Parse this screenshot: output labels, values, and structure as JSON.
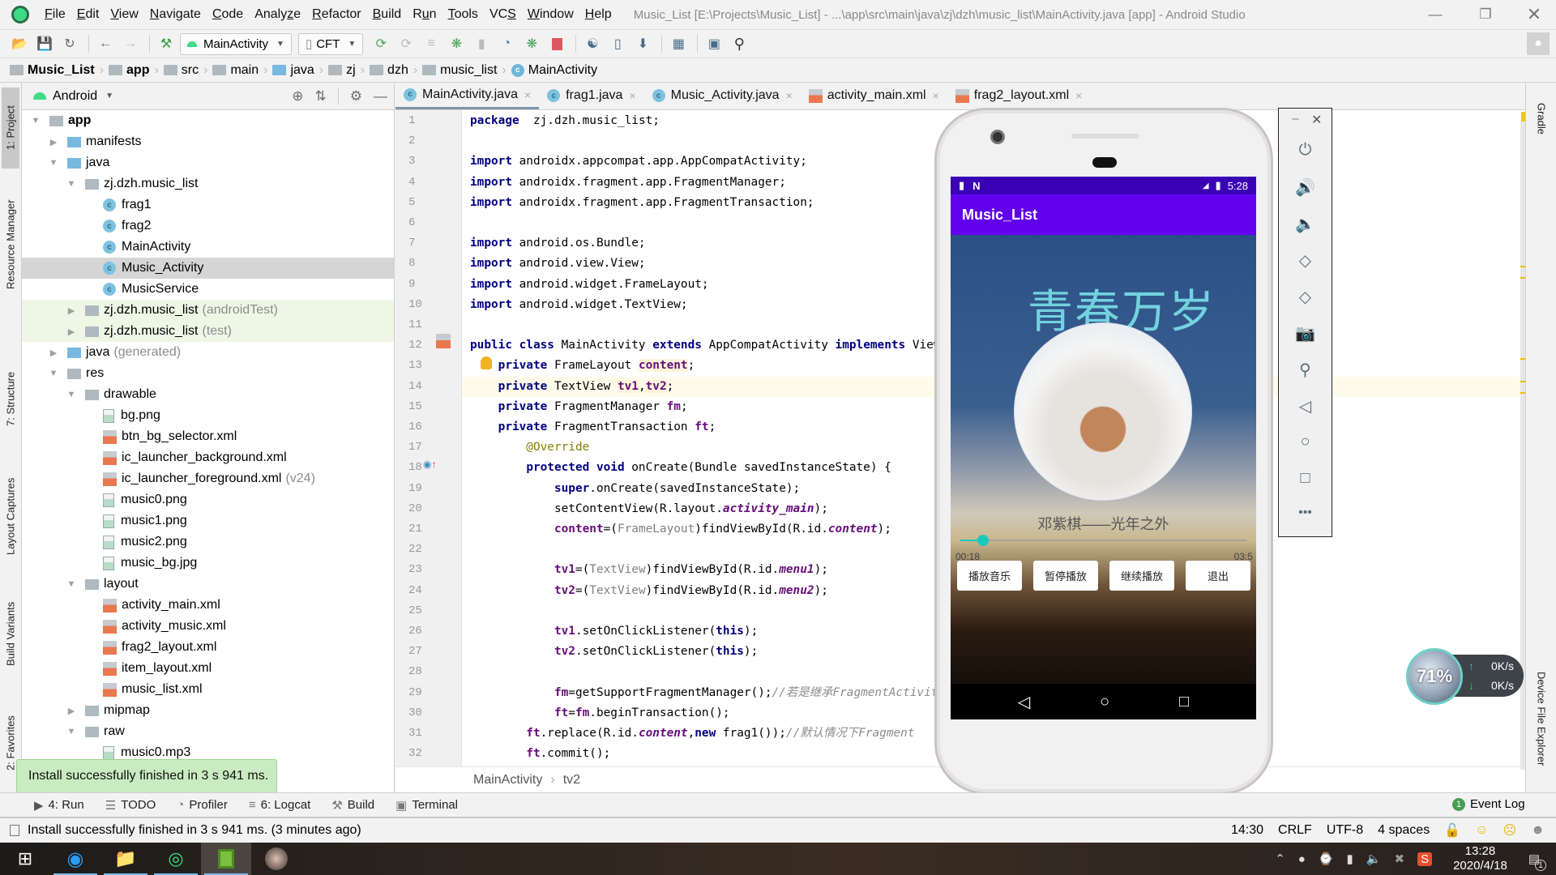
{
  "menu": {
    "items": [
      {
        "label": "File",
        "u": "F"
      },
      {
        "label": "Edit",
        "u": "E"
      },
      {
        "label": "View",
        "u": "V"
      },
      {
        "label": "Navigate",
        "u": "N"
      },
      {
        "label": "Code",
        "u": "C"
      },
      {
        "label": "Analyze",
        "u": "z"
      },
      {
        "label": "Refactor",
        "u": "R"
      },
      {
        "label": "Build",
        "u": "B"
      },
      {
        "label": "Run",
        "u": "u"
      },
      {
        "label": "Tools",
        "u": "T"
      },
      {
        "label": "VCS",
        "u": "S"
      },
      {
        "label": "Window",
        "u": "W"
      },
      {
        "label": "Help",
        "u": "H"
      }
    ],
    "title": "Music_List [E:\\Projects\\Music_List] - ...\\app\\src\\main\\java\\zj\\dzh\\music_list\\MainActivity.java [app] - Android Studio"
  },
  "toolbar": {
    "run_config": "MainActivity",
    "device": "CFT"
  },
  "breadcrumb": [
    "Music_List",
    "app",
    "src",
    "main",
    "java",
    "zj",
    "dzh",
    "music_list",
    "MainActivity"
  ],
  "left_tool_windows": [
    "1: Project",
    "Resource Manager",
    "7: Structure",
    "Layout Captures",
    "Build Variants",
    "2: Favorites"
  ],
  "right_tool_windows": [
    "Gradle",
    "Device File Explorer"
  ],
  "project": {
    "view_mode": "Android",
    "tree": [
      {
        "label": "app",
        "depth": 0,
        "type": "module",
        "expanded": true,
        "bold": true
      },
      {
        "label": "manifests",
        "depth": 1,
        "type": "folder-blue",
        "expanded": false
      },
      {
        "label": "java",
        "depth": 1,
        "type": "folder-blue",
        "expanded": true
      },
      {
        "label": "zj.dzh.music_list",
        "depth": 2,
        "type": "package",
        "expanded": true
      },
      {
        "label": "frag1",
        "depth": 3,
        "type": "class"
      },
      {
        "label": "frag2",
        "depth": 3,
        "type": "class"
      },
      {
        "label": "MainActivity",
        "depth": 3,
        "type": "class"
      },
      {
        "label": "Music_Activity",
        "depth": 3,
        "type": "class",
        "selected": true
      },
      {
        "label": "MusicService",
        "depth": 3,
        "type": "class"
      },
      {
        "label": "zj.dzh.music_list",
        "suffix": "(androidTest)",
        "depth": 2,
        "type": "package",
        "expanded": false,
        "test": true
      },
      {
        "label": "zj.dzh.music_list",
        "suffix": "(test)",
        "depth": 2,
        "type": "package",
        "expanded": false,
        "test": true
      },
      {
        "label": "java",
        "suffix": "(generated)",
        "depth": 1,
        "type": "folder-gen",
        "expanded": false
      },
      {
        "label": "res",
        "depth": 1,
        "type": "folder",
        "expanded": true
      },
      {
        "label": "drawable",
        "depth": 2,
        "type": "package",
        "expanded": true
      },
      {
        "label": "bg.png",
        "depth": 3,
        "type": "image"
      },
      {
        "label": "btn_bg_selector.xml",
        "depth": 3,
        "type": "xml"
      },
      {
        "label": "ic_launcher_background.xml",
        "depth": 3,
        "type": "xml"
      },
      {
        "label": "ic_launcher_foreground.xml",
        "suffix": "(v24)",
        "depth": 3,
        "type": "xml"
      },
      {
        "label": "music0.png",
        "depth": 3,
        "type": "image"
      },
      {
        "label": "music1.png",
        "depth": 3,
        "type": "image"
      },
      {
        "label": "music2.png",
        "depth": 3,
        "type": "image"
      },
      {
        "label": "music_bg.jpg",
        "depth": 3,
        "type": "image"
      },
      {
        "label": "layout",
        "depth": 2,
        "type": "package",
        "expanded": true
      },
      {
        "label": "activity_main.xml",
        "depth": 3,
        "type": "xml"
      },
      {
        "label": "activity_music.xml",
        "depth": 3,
        "type": "xml"
      },
      {
        "label": "frag2_layout.xml",
        "depth": 3,
        "type": "xml"
      },
      {
        "label": "item_layout.xml",
        "depth": 3,
        "type": "xml"
      },
      {
        "label": "music_list.xml",
        "depth": 3,
        "type": "xml"
      },
      {
        "label": "mipmap",
        "depth": 2,
        "type": "package",
        "expanded": false
      },
      {
        "label": "raw",
        "depth": 2,
        "type": "package",
        "expanded": true
      },
      {
        "label": "music0.mp3",
        "depth": 3,
        "type": "image"
      }
    ]
  },
  "editor": {
    "tabs": [
      {
        "label": "MainActivity.java",
        "type": "class",
        "active": true
      },
      {
        "label": "frag1.java",
        "type": "class"
      },
      {
        "label": "Music_Activity.java",
        "type": "class"
      },
      {
        "label": "activity_main.xml",
        "type": "xml"
      },
      {
        "label": "frag2_layout.xml",
        "type": "xml"
      }
    ],
    "lines": [
      [
        [
          "kw",
          "package"
        ],
        [
          "",
          "  zj.dzh.music_list;"
        ]
      ],
      [],
      [
        [
          "kw",
          "import"
        ],
        [
          "",
          " androidx.appcompat.app.AppCompatActivity;"
        ]
      ],
      [
        [
          "kw",
          "import"
        ],
        [
          "",
          " androidx.fragment.app.FragmentManager;"
        ]
      ],
      [
        [
          "kw",
          "import"
        ],
        [
          "",
          " androidx.fragment.app.FragmentTransaction;"
        ]
      ],
      [],
      [
        [
          "kw",
          "import"
        ],
        [
          "",
          " android.os.Bundle;"
        ]
      ],
      [
        [
          "kw",
          "import"
        ],
        [
          "",
          " android.view.View;"
        ]
      ],
      [
        [
          "kw",
          "import"
        ],
        [
          "",
          " android.widget.FrameLayout;"
        ]
      ],
      [
        [
          "kw",
          "import"
        ],
        [
          "",
          " android.widget.TextView;"
        ]
      ],
      [],
      [
        [
          "kw",
          "public class"
        ],
        [
          "",
          " MainActivity "
        ],
        [
          "kw",
          "extends"
        ],
        [
          "",
          " AppCompatActivity "
        ],
        [
          "kw",
          "implements"
        ],
        [
          "",
          " View.OnClickListener {"
        ]
      ],
      [
        [
          "",
          "    "
        ],
        [
          "kw",
          "private"
        ],
        [
          "",
          " FrameLayout "
        ],
        [
          "fld hl",
          "content"
        ],
        [
          "",
          ";"
        ]
      ],
      [
        [
          "",
          "    "
        ],
        [
          "kw",
          "private"
        ],
        [
          "",
          " TextView "
        ],
        [
          "fld hl",
          "tv1"
        ],
        [
          "",
          ","
        ],
        [
          "fld hl",
          "tv2"
        ],
        [
          "",
          ";"
        ]
      ],
      [
        [
          "",
          "    "
        ],
        [
          "kw",
          "private"
        ],
        [
          "",
          " FragmentManager "
        ],
        [
          "fld",
          "fm"
        ],
        [
          "",
          ";"
        ]
      ],
      [
        [
          "",
          "    "
        ],
        [
          "kw",
          "private"
        ],
        [
          "",
          " FragmentTransaction "
        ],
        [
          "fld",
          "ft"
        ],
        [
          "",
          ";"
        ]
      ],
      [
        [
          "an",
          "        @Override"
        ]
      ],
      [
        [
          "",
          "        "
        ],
        [
          "kw",
          "protected void"
        ],
        [
          "",
          " onCreate(Bundle savedInstanceState) {"
        ]
      ],
      [
        [
          "",
          "            "
        ],
        [
          "kw",
          "super"
        ],
        [
          "",
          ".onCreate(savedInstanceState);"
        ]
      ],
      [
        [
          "",
          "            setContentView(R.layout."
        ],
        [
          "it",
          "activity_main"
        ],
        [
          "",
          ");"
        ]
      ],
      [
        [
          "",
          "            "
        ],
        [
          "fld",
          "content"
        ],
        [
          "",
          "=("
        ],
        [
          "gr",
          "FrameLayout"
        ],
        [
          "",
          ")findViewById(R.id."
        ],
        [
          "it",
          "content"
        ],
        [
          "",
          ");"
        ]
      ],
      [],
      [
        [
          "",
          "            "
        ],
        [
          "fld",
          "tv1"
        ],
        [
          "",
          "=("
        ],
        [
          "gr",
          "TextView"
        ],
        [
          "",
          ")findViewById(R.id."
        ],
        [
          "it",
          "menu1"
        ],
        [
          "",
          ");"
        ]
      ],
      [
        [
          "",
          "            "
        ],
        [
          "fld",
          "tv2"
        ],
        [
          "",
          "=("
        ],
        [
          "gr",
          "TextView"
        ],
        [
          "",
          ")findViewById(R.id."
        ],
        [
          "it",
          "menu2"
        ],
        [
          "",
          ");"
        ]
      ],
      [],
      [
        [
          "",
          "            "
        ],
        [
          "fld",
          "tv1"
        ],
        [
          "",
          ".setOnClickListener("
        ],
        [
          "kw",
          "this"
        ],
        [
          "",
          ");"
        ]
      ],
      [
        [
          "",
          "            "
        ],
        [
          "fld",
          "tv2"
        ],
        [
          "",
          ".setOnClickListener("
        ],
        [
          "kw",
          "this"
        ],
        [
          "",
          ");"
        ]
      ],
      [],
      [
        [
          "",
          "            "
        ],
        [
          "fld",
          "fm"
        ],
        [
          "",
          "=getSupportFragmentManager();"
        ],
        [
          "cm",
          "//若是继承FragmentActivity"
        ]
      ],
      [
        [
          "",
          "            "
        ],
        [
          "fld",
          "ft"
        ],
        [
          "",
          "="
        ],
        [
          "fld",
          "fm"
        ],
        [
          "",
          ".beginTransaction();"
        ]
      ],
      [
        [
          "",
          "        "
        ],
        [
          "fld",
          "ft"
        ],
        [
          "",
          ".replace(R.id."
        ],
        [
          "it",
          "content"
        ],
        [
          "",
          ","
        ],
        [
          "kw",
          "new"
        ],
        [
          "",
          " frag1());"
        ],
        [
          "cm",
          "//默认情况下Fragment"
        ]
      ],
      [
        [
          "",
          "        "
        ],
        [
          "fld",
          "ft"
        ],
        [
          "",
          ".commit();"
        ]
      ]
    ],
    "footer_breadcrumb": [
      "MainActivity",
      "tv2"
    ]
  },
  "emulator": {
    "status_time": "5:28",
    "app_title": "Music_List",
    "album_art_text": "青春万岁",
    "song_title": "邓紫棋——光年之外",
    "elapsed": "00:18",
    "duration": "03:5",
    "progress_fraction": 0.08,
    "buttons": [
      "播放音乐",
      "暂停播放",
      "继续播放",
      "退出"
    ],
    "controls": [
      "power",
      "volume-up",
      "volume-down",
      "rotate-left",
      "rotate-right",
      "screenshot",
      "zoom",
      "back",
      "home",
      "overview",
      "more"
    ]
  },
  "net_widget": {
    "percent": "71%",
    "up": "0K/s",
    "down": "0K/s"
  },
  "bottom_tools": [
    {
      "label": "4: Run",
      "icon": "run"
    },
    {
      "label": "TODO",
      "icon": "todo"
    },
    {
      "label": "Profiler",
      "icon": "profiler"
    },
    {
      "label": "6: Logcat",
      "icon": "logcat"
    },
    {
      "label": "Build",
      "icon": "build"
    },
    {
      "label": "Terminal",
      "icon": "terminal"
    }
  ],
  "event_log": {
    "label": "Event Log",
    "count": "1"
  },
  "balloon": "Install successfully finished in 3 s 941 ms.",
  "status": {
    "message": "Install successfully finished in 3 s 941 ms. (3 minutes ago)",
    "position": "14:30",
    "line_sep": "CRLF",
    "encoding": "UTF-8",
    "indent": "4 spaces"
  },
  "taskbar": {
    "time": "13:28",
    "date": "2020/4/18",
    "notifications": "1"
  }
}
